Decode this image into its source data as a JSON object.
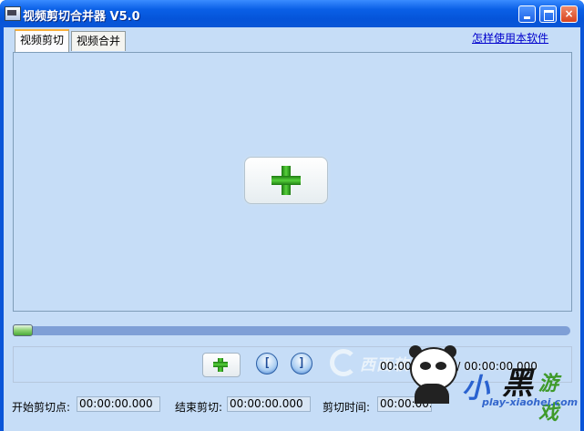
{
  "window": {
    "title": "视频剪切合并器 V5.0",
    "buttons": {
      "minimize": "minimize",
      "maximize": "maximize",
      "close": "×"
    }
  },
  "tabs": [
    {
      "label": "视频剪切",
      "active": true
    },
    {
      "label": "视频合并",
      "active": false
    }
  ],
  "help_link": "怎样使用本软件",
  "preview": {
    "icon": "add-video-icon"
  },
  "timeline": {
    "progress": 0.0
  },
  "controls": {
    "add_icon": "add-icon",
    "mark_start_glyph": "[",
    "mark_end_glyph": "]",
    "time_readout": "00:00:00.000 / 00:00:00.000"
  },
  "watermark": {
    "text": "西西软件园"
  },
  "fields": {
    "start_label": "开始剪切点:",
    "start_value": "00:00:00.000",
    "end_label": "结束剪切:",
    "end_value": "00:00:00.000",
    "duration_label": "剪切时间:",
    "duration_value": "00:00:00.000"
  },
  "site_logo": {
    "chars": [
      "小",
      "黑",
      "游戏"
    ],
    "url": "play-xiaohei.com"
  },
  "colors": {
    "titlebar": "#0a5fe6",
    "client_bg": "#c6ddf7",
    "accent_green": "#2a9a22",
    "link": "#0000cc"
  }
}
